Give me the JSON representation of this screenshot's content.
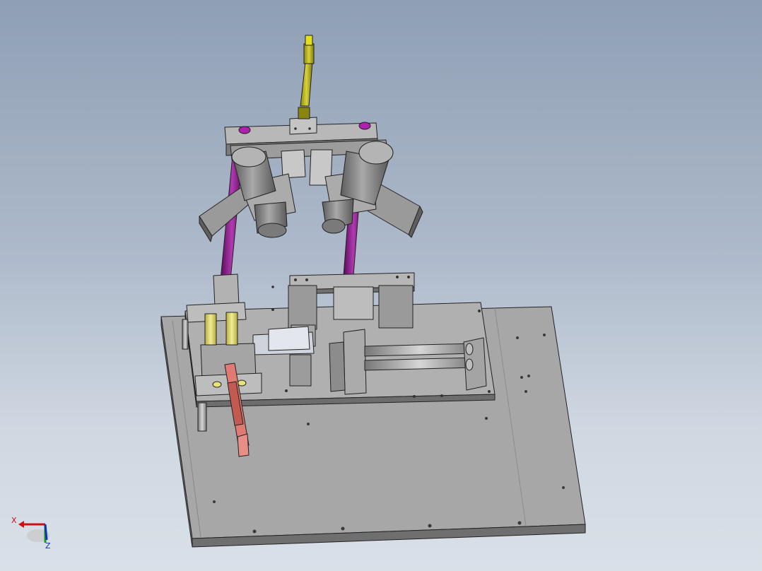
{
  "viewport": {
    "background_top": "#8f9fb4",
    "background_bottom": "#d9e0e8"
  },
  "model": {
    "description_parts": [
      "base-plate",
      "sub-plate",
      "gripper-bridge",
      "twin-motors",
      "vertical-cylinder",
      "inclined-cylinder",
      "linear-rail",
      "guide-pillars"
    ],
    "colors": {
      "steel": "#a4a4a4",
      "steel_dark": "#6e6e6e",
      "edge": "#222222",
      "cylinder_yellow": "#c8c21c",
      "pillar_yellow": "#e8e27a",
      "cylinder_red": "#e07a72",
      "column_purple": "#8a1a8a",
      "motor_grey": "#8d8d8d"
    }
  },
  "triad": {
    "x_label": "X",
    "z_label": "Z",
    "x_color": "#d01010",
    "y_color": "#10a010",
    "z_color": "#1030c0"
  }
}
